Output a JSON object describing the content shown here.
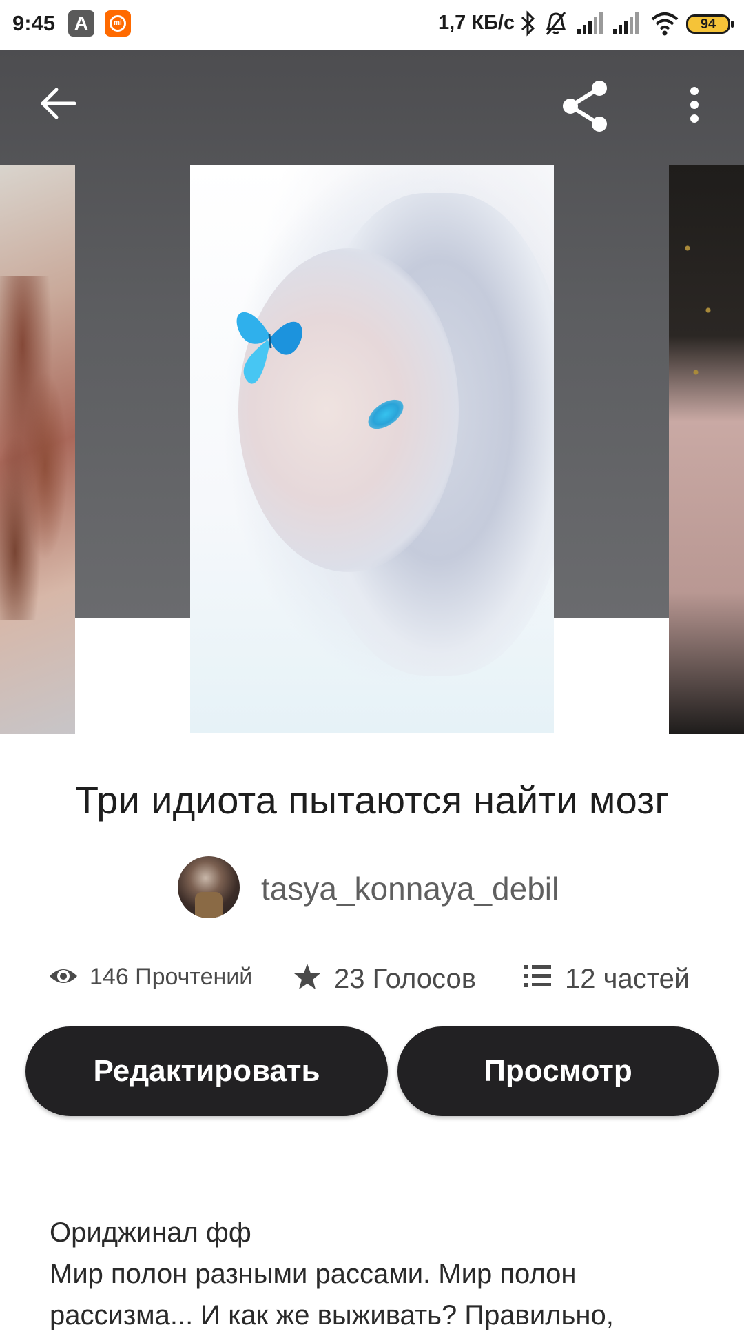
{
  "status_bar": {
    "time": "9:45",
    "app_icon_1": "A",
    "app_icon_2": "mi",
    "network_speed": "1,7 КБ/с",
    "battery": "94",
    "icons": [
      "bluetooth-icon",
      "silent-bell-icon",
      "signal-icon",
      "signal-icon",
      "wifi-icon",
      "battery-icon"
    ]
  },
  "toolbar": {
    "back_icon": "arrow-left-icon",
    "share_icon": "share-icon",
    "more_icon": "more-vertical-icon"
  },
  "story": {
    "title": "Три идиота пытаются найти мозг",
    "author": "tasya_konnaya_debil",
    "stats": {
      "reads": "146 Прочтений",
      "votes": "23 Голосов",
      "parts": "12 частей"
    }
  },
  "actions": {
    "edit_label": "Редактировать",
    "view_label": "Просмотр"
  },
  "description": {
    "line1": "Ориджинал фф",
    "line2": "Мир полон разными рассами. Мир полон",
    "line3": "рассизма... И как же выживать? Правильно,"
  },
  "colors": {
    "button_bg": "#222123",
    "hero_bg": "#5c5d60",
    "battery": "#f5c338",
    "mi_orange": "#ff6a00"
  }
}
